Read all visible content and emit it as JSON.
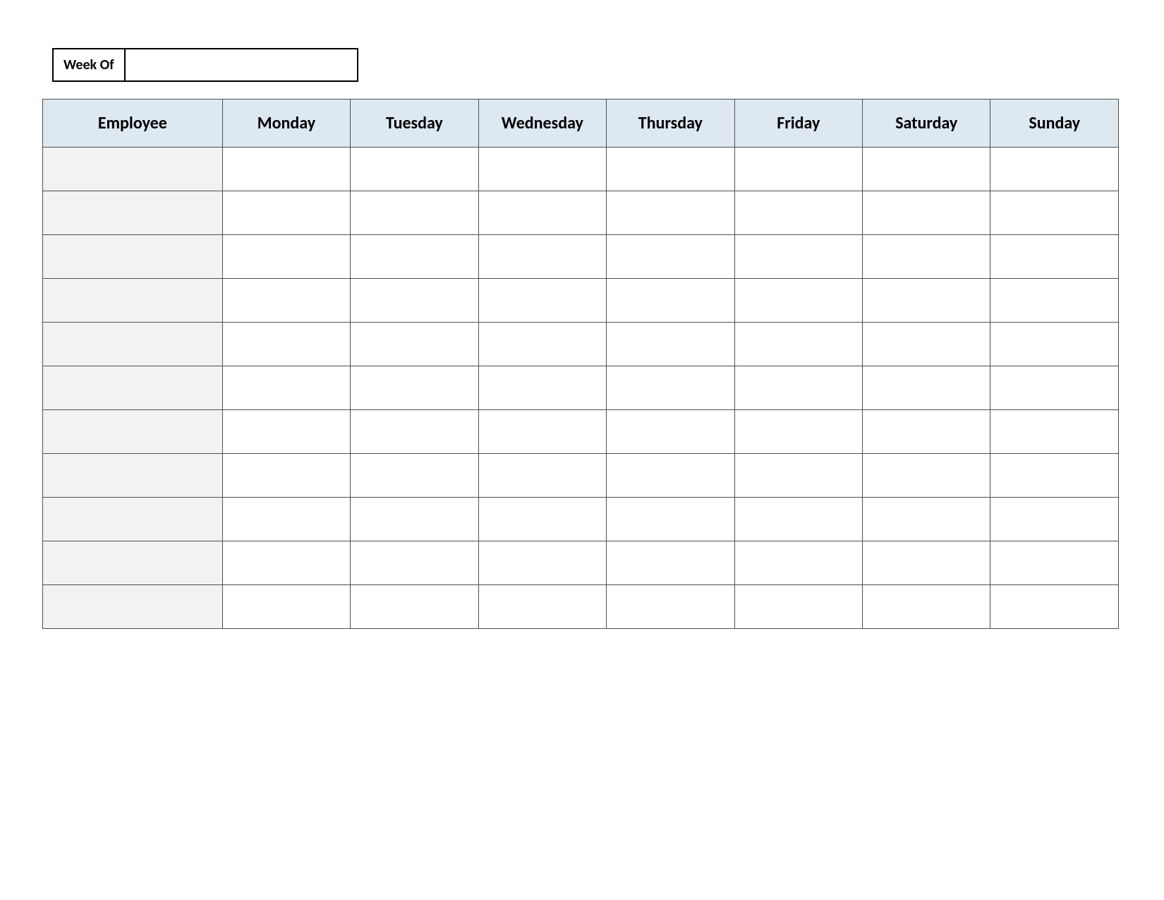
{
  "weekof": {
    "label": "Week Of",
    "value": ""
  },
  "table": {
    "headers": [
      "Employee",
      "Monday",
      "Tuesday",
      "Wednesday",
      "Thursday",
      "Friday",
      "Saturday",
      "Sunday"
    ],
    "rows": [
      {
        "employee": "",
        "days": [
          "",
          "",
          "",
          "",
          "",
          "",
          ""
        ]
      },
      {
        "employee": "",
        "days": [
          "",
          "",
          "",
          "",
          "",
          "",
          ""
        ]
      },
      {
        "employee": "",
        "days": [
          "",
          "",
          "",
          "",
          "",
          "",
          ""
        ]
      },
      {
        "employee": "",
        "days": [
          "",
          "",
          "",
          "",
          "",
          "",
          ""
        ]
      },
      {
        "employee": "",
        "days": [
          "",
          "",
          "",
          "",
          "",
          "",
          ""
        ]
      },
      {
        "employee": "",
        "days": [
          "",
          "",
          "",
          "",
          "",
          "",
          ""
        ]
      },
      {
        "employee": "",
        "days": [
          "",
          "",
          "",
          "",
          "",
          "",
          ""
        ]
      },
      {
        "employee": "",
        "days": [
          "",
          "",
          "",
          "",
          "",
          "",
          ""
        ]
      },
      {
        "employee": "",
        "days": [
          "",
          "",
          "",
          "",
          "",
          "",
          ""
        ]
      },
      {
        "employee": "",
        "days": [
          "",
          "",
          "",
          "",
          "",
          "",
          ""
        ]
      },
      {
        "employee": "",
        "days": [
          "",
          "",
          "",
          "",
          "",
          "",
          ""
        ]
      }
    ]
  }
}
